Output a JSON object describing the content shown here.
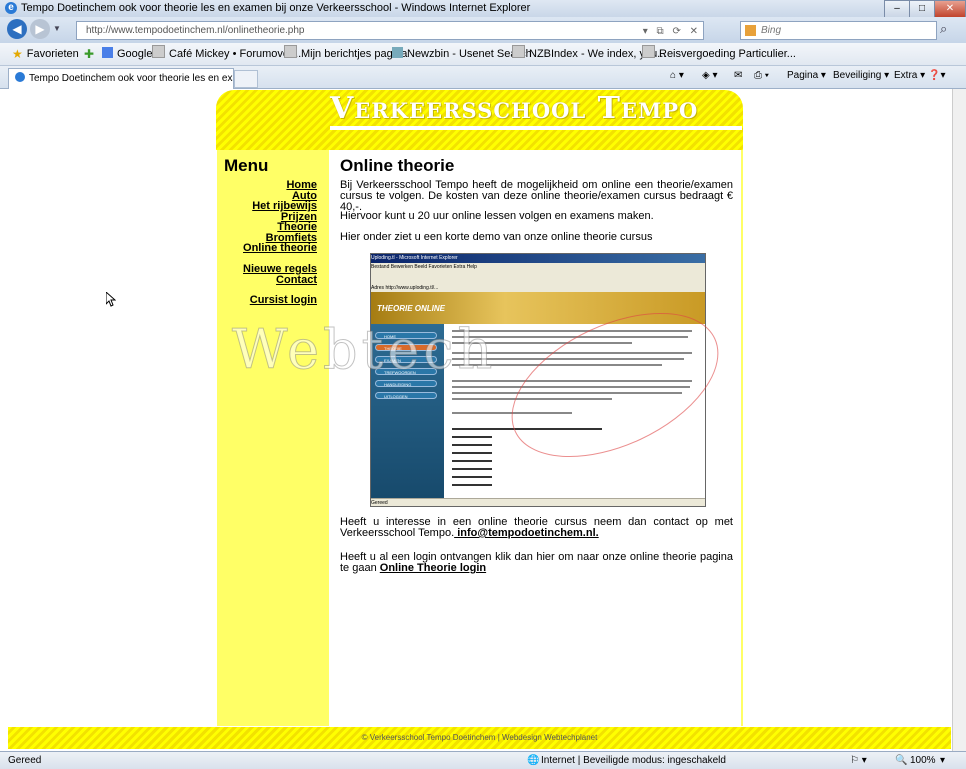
{
  "window": {
    "title": "Tempo Doetinchem ook voor theorie les en examen bij onze Verkeersschool - Windows Internet Explorer",
    "min_label": "–",
    "max_label": "□",
    "close_label": "✕"
  },
  "address_bar": {
    "url": "http://www.tempodoetinchem.nl/onlinetheorie.php",
    "search_placeholder": "Bing"
  },
  "favorites_bar": {
    "favorites_label": "Favorieten",
    "items": [
      "Google",
      "Café Mickey • Forumover...",
      "Mijn berichtjes pagina",
      "Newzbin - Usenet Search",
      "NZBIndex - We index, you...",
      "Reisvergoeding Particulier..."
    ]
  },
  "tab": {
    "label": "Tempo Doetinchem ook voor theorie les en exam..."
  },
  "command_bar": {
    "pagina": "Pagina ▾",
    "beveiliging": "Beveiliging ▾",
    "extra": "Extra ▾"
  },
  "site": {
    "title": "Verkeersschool Tempo",
    "menu_heading": "Menu",
    "menu_items": [
      "Home",
      "Auto",
      "Het rijbewijs",
      "Prijzen",
      "Theorie",
      "Bromfiets",
      "Online theorie",
      "Nieuwe regels",
      "Contact",
      "Cursist login"
    ],
    "content_title": "Online theorie",
    "para1": "Bij Verkeersschool Tempo heeft de mogelijkheid om online een theorie/examen cursus te volgen. De kosten van deze online theorie/examen cursus bedraagt € 40,-.",
    "para1b": "Hiervoor kunt u 20 uur online lessen volgen en examens maken.",
    "para2": "Hier onder ziet u een korte demo van onze online theorie cursus",
    "para3": "Heeft u interesse in een online theorie cursus neem dan contact op met Verkeersschool Tempo.",
    "email": " info@tempodoetinchem.nl.",
    "para4": "Heeft u al een login ontvangen klik dan hier om naar onze online theorie pagina te gaan",
    "login_link": "Online Theorie login",
    "watermark": "Webtech",
    "footer": "© Verkeersschool Tempo Doetinchem | Webdesign Webtechplanet"
  },
  "demo": {
    "title": "Uploding.tl - Microsoft Internet Explorer",
    "menu": "Bestand   Bewerken   Beeld   Favorieten   Extra   Help",
    "address": "Adres   http://www.uploding.tl/...",
    "logo": "THEORIE ONLINE",
    "nav": [
      "HOME",
      "THEORIE",
      "EXAMEN",
      "TREFWOORDEN",
      "HANDLEIDING",
      "UITLOGGEN"
    ],
    "status": "Gereed"
  },
  "status_bar": {
    "status": "Gereed",
    "zone": "Internet | Beveiligde modus: ingeschakeld",
    "zoom": "100%"
  }
}
